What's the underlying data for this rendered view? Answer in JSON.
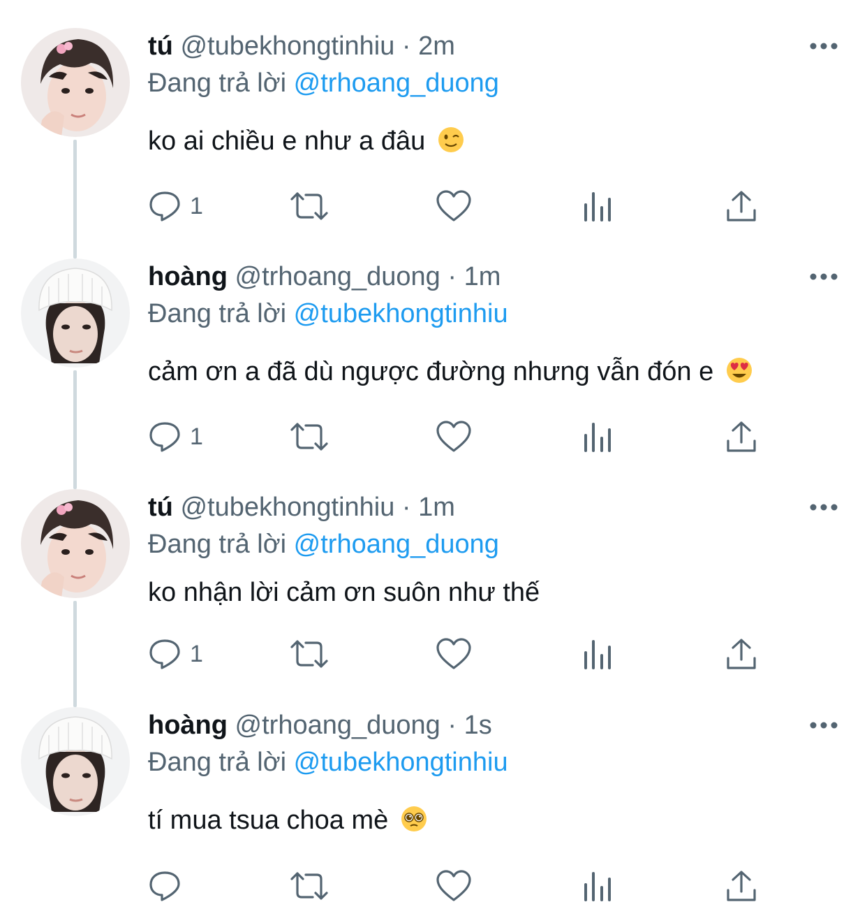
{
  "thread": {
    "tweets": [
      {
        "name": "tú",
        "handle": "@tubekhongtinhiu",
        "separator": "·",
        "time": "2m",
        "replying_prefix": "Đang trả lời",
        "replying_to": "@trhoang_duong",
        "text": "ko ai chiều e như a đâu",
        "emoji_icon": "winking-face-emoji",
        "reply_count": "1",
        "avatar_icon": "avatar-pink-clip"
      },
      {
        "name": "hoàng",
        "handle": "@trhoang_duong",
        "separator": "·",
        "time": "1m",
        "replying_prefix": "Đang trả lời",
        "replying_to": "@tubekhongtinhiu",
        "text": "cảm ơn a đã dù ngược đường nhưng vẫn đón e",
        "emoji_icon": "heart-eyes-emoji",
        "reply_count": "1",
        "avatar_icon": "avatar-white-beanie"
      },
      {
        "name": "tú",
        "handle": "@tubekhongtinhiu",
        "separator": "·",
        "time": "1m",
        "replying_prefix": "Đang trả lời",
        "replying_to": "@trhoang_duong",
        "text": "ko nhận lời cảm ơn suôn như thế",
        "reply_count": "1",
        "avatar_icon": "avatar-pink-clip"
      },
      {
        "name": "hoàng",
        "handle": "@trhoang_duong",
        "separator": "·",
        "time": "1s",
        "replying_prefix": "Đang trả lời",
        "replying_to": "@tubekhongtinhiu",
        "text": "tí mua tsua choa mè",
        "emoji_icon": "pleading-face-emoji",
        "reply_count": "",
        "avatar_icon": "avatar-white-beanie"
      }
    ],
    "action_icons": [
      "reply-icon",
      "retweet-icon",
      "like-icon",
      "views-icon",
      "share-icon"
    ],
    "colors": {
      "link": "#1d9bf0",
      "secondary_text": "#536471",
      "primary_text": "#0f1419",
      "connector": "#cfd9de"
    }
  }
}
